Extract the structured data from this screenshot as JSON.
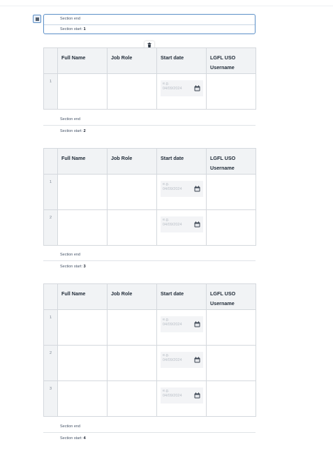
{
  "labels": {
    "section_end": "Section end",
    "section_start_prefix": "Section start:"
  },
  "sections": [
    {
      "start_number": "1",
      "start_label": "Section start:",
      "end_label": "Section end"
    },
    {
      "start_number": "2",
      "start_label": "Section start:",
      "end_label": "Section end"
    },
    {
      "start_number": "3",
      "start_label": "Section start:",
      "end_label": "Section end"
    },
    {
      "start_number": "4",
      "start_label": "Section start:",
      "end_label": "Section end"
    }
  ],
  "table": {
    "columns": [
      "Full Name",
      "Job Role",
      "Start date",
      "LGFL USO Username"
    ],
    "date_placeholder_line1": "e.g.",
    "date_placeholder_line2": "04/09/2024"
  },
  "tables": [
    {
      "rows": [
        "1"
      ]
    },
    {
      "rows": [
        "1",
        "2"
      ]
    },
    {
      "rows": [
        "1",
        "2",
        "3"
      ]
    }
  ],
  "icons": {
    "drag_handle": "square-handle-icon",
    "delete": "trash-icon",
    "calendar": "calendar-icon"
  },
  "colors": {
    "accent": "#5b8fc7",
    "header_bg": "#f1f3f5",
    "border": "#d4d8dd"
  }
}
